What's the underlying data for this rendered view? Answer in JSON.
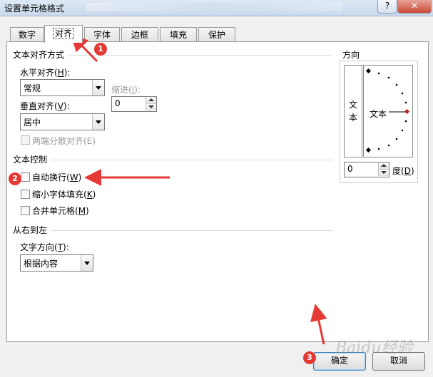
{
  "window": {
    "title": "设置单元格格式",
    "help_label": "?",
    "close_label": "✕"
  },
  "tabs": [
    {
      "label": "数字"
    },
    {
      "label": "对齐"
    },
    {
      "label": "字体"
    },
    {
      "label": "边框"
    },
    {
      "label": "填充"
    },
    {
      "label": "保护"
    }
  ],
  "alignment": {
    "section_title": "文本对齐方式",
    "horizontal": {
      "label": "水平对齐(",
      "key": "H",
      "suffix": "):",
      "value": "常规"
    },
    "indent": {
      "label": "缩进(",
      "key": "I",
      "suffix": "):",
      "value": "0"
    },
    "vertical": {
      "label": "垂直对齐(",
      "key": "V",
      "suffix": "):",
      "value": "居中"
    },
    "distributed": {
      "label": "两端分散对齐(E)"
    }
  },
  "text_control": {
    "section_title": "文本控制",
    "wrap": {
      "label": "自动换行(",
      "key": "W",
      "suffix": ")"
    },
    "shrink": {
      "label": "缩小字体填充(",
      "key": "K",
      "suffix": ")"
    },
    "merge": {
      "label": "合并单元格(",
      "key": "M",
      "suffix": ")"
    }
  },
  "rtl": {
    "section_title": "从右到左",
    "direction": {
      "label": "文字方向(",
      "key": "T",
      "suffix": "):",
      "value": "根据内容"
    }
  },
  "orientation": {
    "section_title": "方向",
    "vertical_text": [
      "文",
      "本"
    ],
    "dial_text": "文本",
    "degrees_value": "0",
    "degrees_label": "度(",
    "degrees_key": "D",
    "degrees_suffix": ")"
  },
  "buttons": {
    "ok": "确定",
    "cancel": "取消"
  },
  "annotations": {
    "marker1": "1",
    "marker2": "2",
    "marker3": "3",
    "color": "#e53935"
  },
  "watermark": "Baidu经验"
}
